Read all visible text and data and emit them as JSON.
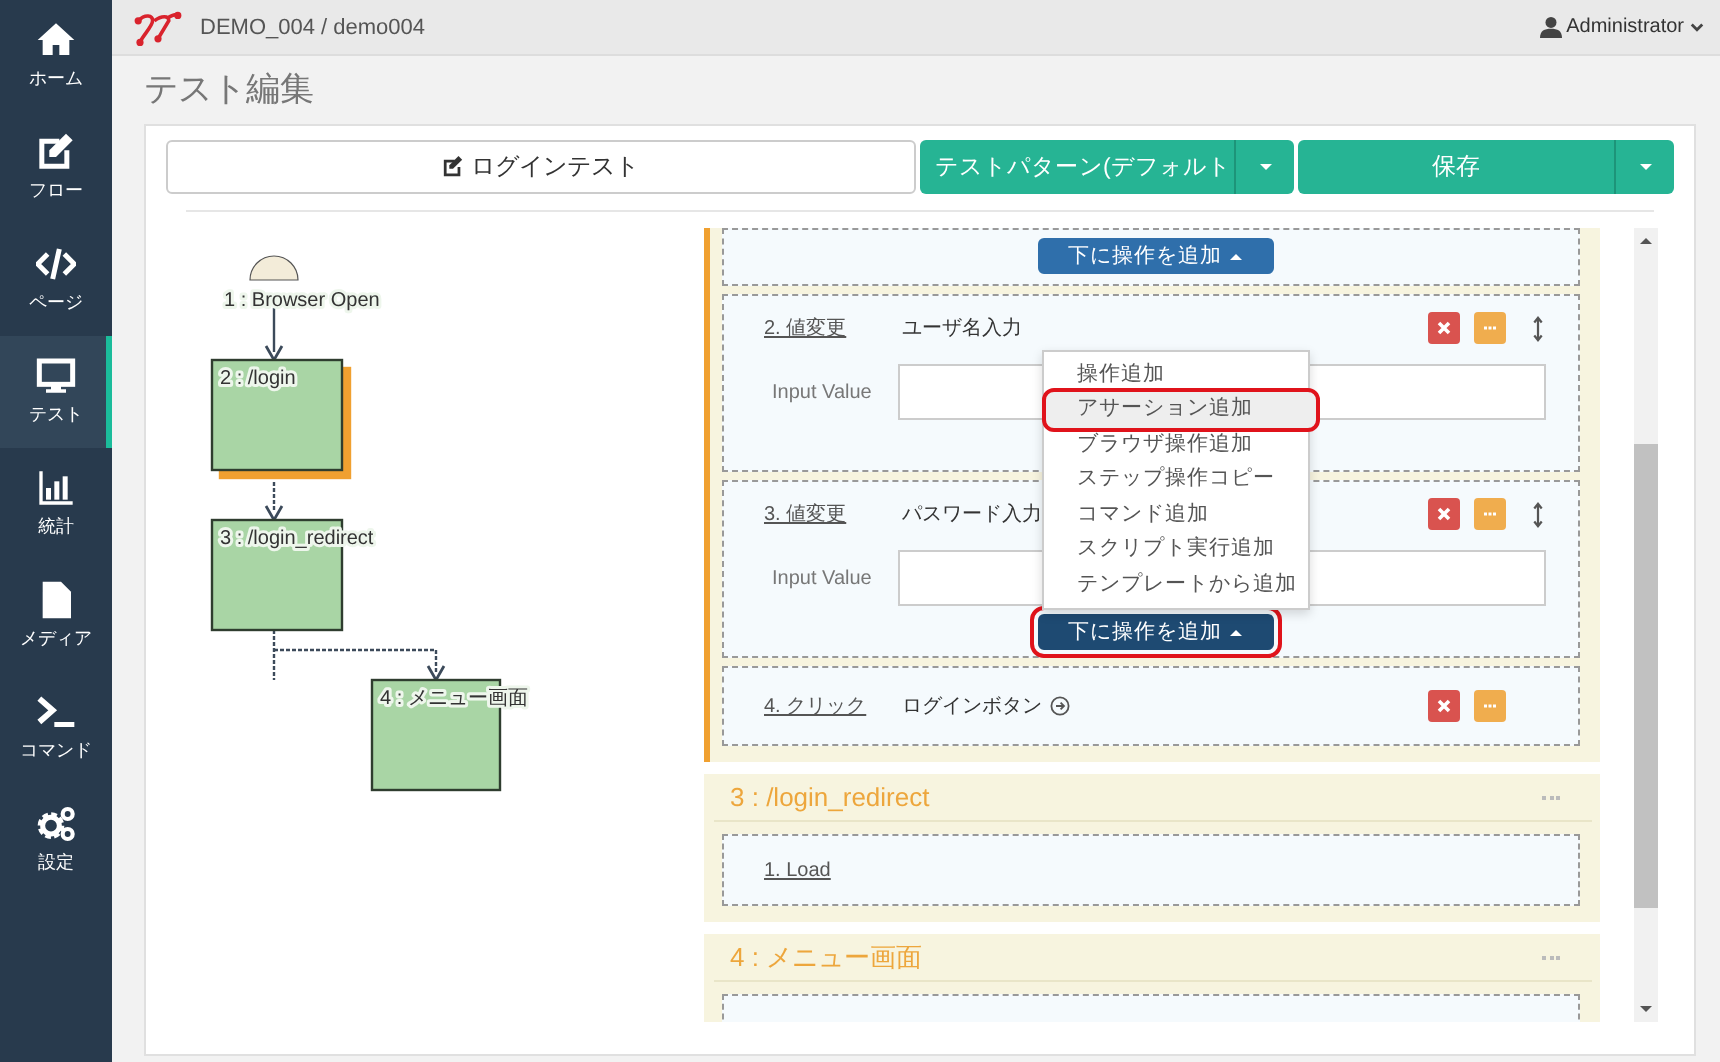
{
  "topbar": {
    "breadcrumb": "DEMO_004 / demo004",
    "user": "Administrator"
  },
  "sidebar": {
    "items": [
      {
        "label": "ホーム",
        "kind": "home",
        "selected": false
      },
      {
        "label": "フロー",
        "kind": "edit",
        "selected": false
      },
      {
        "label": "ページ",
        "kind": "code",
        "selected": false
      },
      {
        "label": "テスト",
        "kind": "monitor",
        "selected": true
      },
      {
        "label": "統計",
        "kind": "chart",
        "selected": false
      },
      {
        "label": "メディア",
        "kind": "file",
        "selected": false
      },
      {
        "label": "コマンド",
        "kind": "terminal",
        "selected": false
      },
      {
        "label": "設定",
        "kind": "gears",
        "selected": false
      }
    ]
  },
  "page_title": "テスト編集",
  "toolbar": {
    "test_name": "ログインテスト",
    "pattern": "テストパターン(デフォルト",
    "save": "保存"
  },
  "flow": {
    "nodes": [
      {
        "label": "1 : Browser Open",
        "kind": "start"
      },
      {
        "label": "2 : /login",
        "kind": "page",
        "selected": true
      },
      {
        "label": "3 : /login_redirect",
        "kind": "page",
        "selected": false
      },
      {
        "label": "4 : メニュー画面",
        "kind": "page",
        "selected": false
      }
    ]
  },
  "groups": [
    {
      "active": true,
      "steps": [
        {
          "kind": "tail",
          "add_button": {
            "label": "下に操作を追加",
            "highlighted": false
          }
        },
        {
          "kind": "input",
          "number": "2. 値変更",
          "target": "ユーザ名入力",
          "input_label": "Input Value"
        },
        {
          "kind": "input",
          "number": "3. 値変更",
          "target": "パスワード入力",
          "input_label": "Input Value",
          "add_button": {
            "label": "下に操作を追加",
            "highlighted": true
          },
          "menu": [
            {
              "label": "操作追加",
              "highlighted": false
            },
            {
              "label": "アサーション追加",
              "highlighted": true
            },
            {
              "label": "ブラウザ操作追加",
              "highlighted": false
            },
            {
              "label": "ステップ操作コピー",
              "highlighted": false
            },
            {
              "label": "コマンド追加",
              "highlighted": false
            },
            {
              "label": "スクリプト実行追加",
              "highlighted": false
            },
            {
              "label": "テンプレートから追加",
              "highlighted": false
            }
          ]
        },
        {
          "kind": "click",
          "number": "4. クリック",
          "target": "ログインボタン"
        }
      ]
    },
    {
      "title": "3 : /login_redirect",
      "active": false,
      "steps": [
        {
          "kind": "load",
          "number": "1. Load"
        }
      ]
    },
    {
      "title": "4 : メニュー画面",
      "active": false,
      "steps": [
        {
          "kind": "empty"
        }
      ]
    }
  ]
}
